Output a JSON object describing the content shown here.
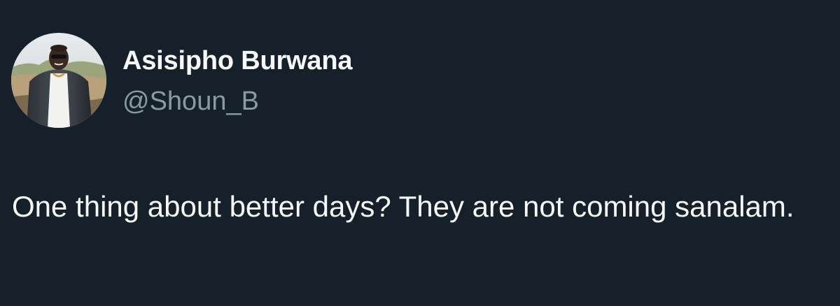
{
  "tweet": {
    "author": {
      "display_name": "Asisipho Burwana",
      "handle": "@Shoun_B",
      "avatar": "profile-photo"
    },
    "text": "One thing about better days? They are not coming sanalam."
  },
  "colors": {
    "background": "#15202b",
    "primary_text": "#f7f9f9",
    "secondary_text": "#8b98a5"
  }
}
